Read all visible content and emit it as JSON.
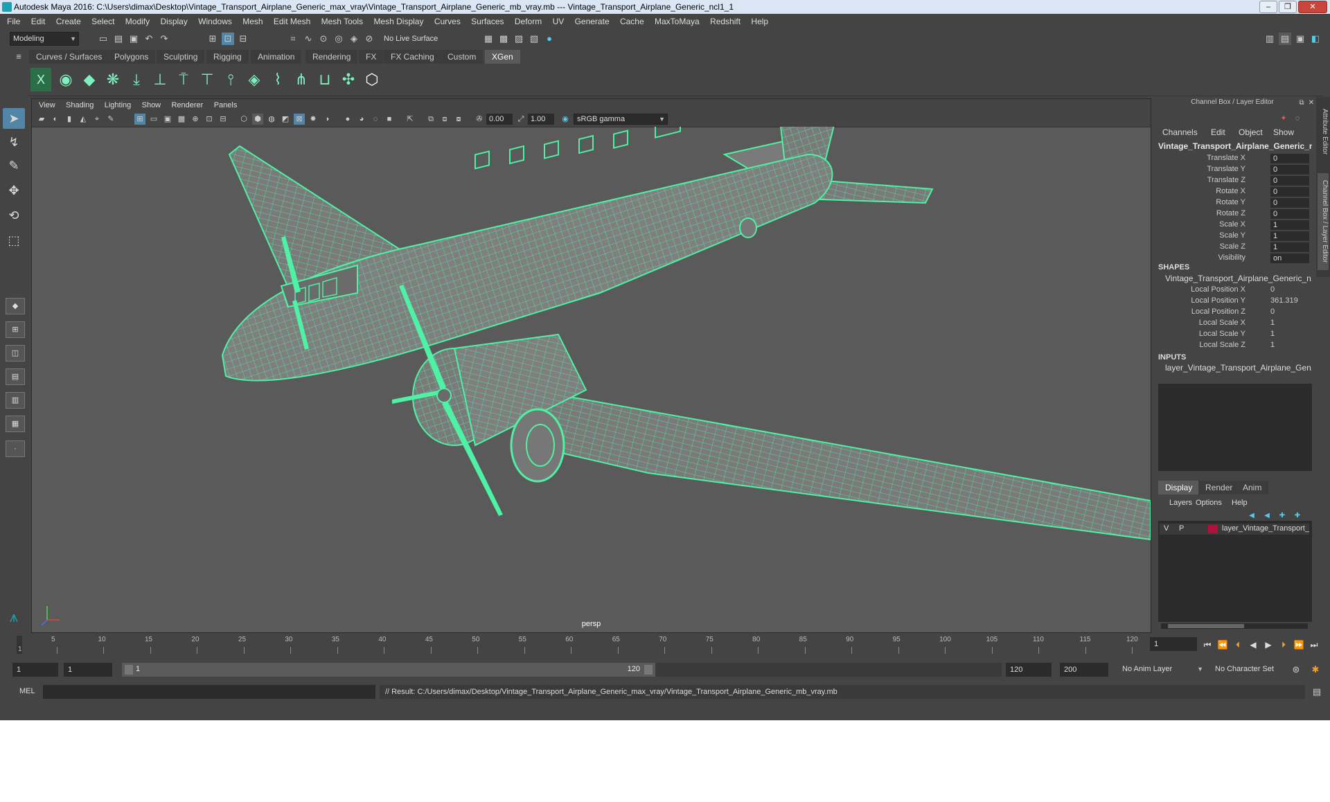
{
  "window": {
    "title": "Autodesk Maya 2016: C:\\Users\\dimax\\Desktop\\Vintage_Transport_Airplane_Generic_max_vray\\Vintage_Transport_Airplane_Generic_mb_vray.mb  ---  Vintage_Transport_Airplane_Generic_ncl1_1"
  },
  "menus": [
    "File",
    "Edit",
    "Create",
    "Select",
    "Modify",
    "Display",
    "Windows",
    "Mesh",
    "Edit Mesh",
    "Mesh Tools",
    "Mesh Display",
    "Curves",
    "Surfaces",
    "Deform",
    "UV",
    "Generate",
    "Cache",
    "MaxToMaya",
    "Redshift",
    "Help"
  ],
  "status_line": {
    "mode": "Modeling",
    "live_surface": "No Live Surface"
  },
  "shelf_tabs": [
    "Curves / Surfaces",
    "Polygons",
    "Sculpting",
    "Rigging",
    "Animation",
    "Rendering",
    "FX",
    "FX Caching",
    "Custom",
    "XGen"
  ],
  "active_shelf": "XGen",
  "panel_menus": [
    "View",
    "Shading",
    "Lighting",
    "Show",
    "Renderer",
    "Panels"
  ],
  "panel_toolbar": {
    "exposure": "0.00",
    "gamma": "1.00",
    "color_space": "sRGB gamma"
  },
  "viewport": {
    "camera_label": "persp",
    "wire_color": "#4ef2a4"
  },
  "channel_box": {
    "title": "Channel Box / Layer Editor",
    "menus": [
      "Channels",
      "Edit",
      "Object",
      "Show"
    ],
    "object_name": "Vintage_Transport_Airplane_Generic_ncl...",
    "attributes": [
      {
        "label": "Translate X",
        "value": "0"
      },
      {
        "label": "Translate Y",
        "value": "0"
      },
      {
        "label": "Translate Z",
        "value": "0"
      },
      {
        "label": "Rotate X",
        "value": "0"
      },
      {
        "label": "Rotate Y",
        "value": "0"
      },
      {
        "label": "Rotate Z",
        "value": "0"
      },
      {
        "label": "Scale X",
        "value": "1"
      },
      {
        "label": "Scale Y",
        "value": "1"
      },
      {
        "label": "Scale Z",
        "value": "1"
      },
      {
        "label": "Visibility",
        "value": "on"
      }
    ],
    "shapes_header": "SHAPES",
    "shape_name": "Vintage_Transport_Airplane_Generic_n...",
    "shape_attributes": [
      {
        "label": "Local Position X",
        "value": "0"
      },
      {
        "label": "Local Position Y",
        "value": "361.319"
      },
      {
        "label": "Local Position Z",
        "value": "0"
      },
      {
        "label": "Local Scale X",
        "value": "1"
      },
      {
        "label": "Local Scale Y",
        "value": "1"
      },
      {
        "label": "Local Scale Z",
        "value": "1"
      }
    ],
    "inputs_header": "INPUTS",
    "input_name": "layer_Vintage_Transport_Airplane_Gen..."
  },
  "layer_editor": {
    "tabs": [
      "Display",
      "Render",
      "Anim"
    ],
    "active_tab": "Display",
    "menus": [
      "Layers",
      "Options",
      "Help"
    ],
    "layer": {
      "v": "V",
      "p": "P",
      "color": "#b0103a",
      "name": "layer_Vintage_Transport_"
    }
  },
  "side_tabs": [
    "Attribute Editor",
    "Channel Box / Layer Editor"
  ],
  "timeline": {
    "ticks": [
      "5",
      "10",
      "15",
      "20",
      "25",
      "30",
      "35",
      "40",
      "45",
      "50",
      "55",
      "60",
      "65",
      "70",
      "75",
      "80",
      "85",
      "90",
      "95",
      "100",
      "105",
      "110",
      "115",
      "120"
    ],
    "current_frame_marker": "1",
    "current_frame": "1"
  },
  "range": {
    "start": "1",
    "playback_start": "1",
    "slider_start": "1",
    "slider_end": "120",
    "playback_end": "120",
    "end": "200",
    "anim_layer": "No Anim Layer",
    "character_set": "No Character Set"
  },
  "command_line": {
    "label": "MEL",
    "result": "// Result: C:/Users/dimax/Desktop/Vintage_Transport_Airplane_Generic_max_vray/Vintage_Transport_Airplane_Generic_mb_vray.mb"
  }
}
